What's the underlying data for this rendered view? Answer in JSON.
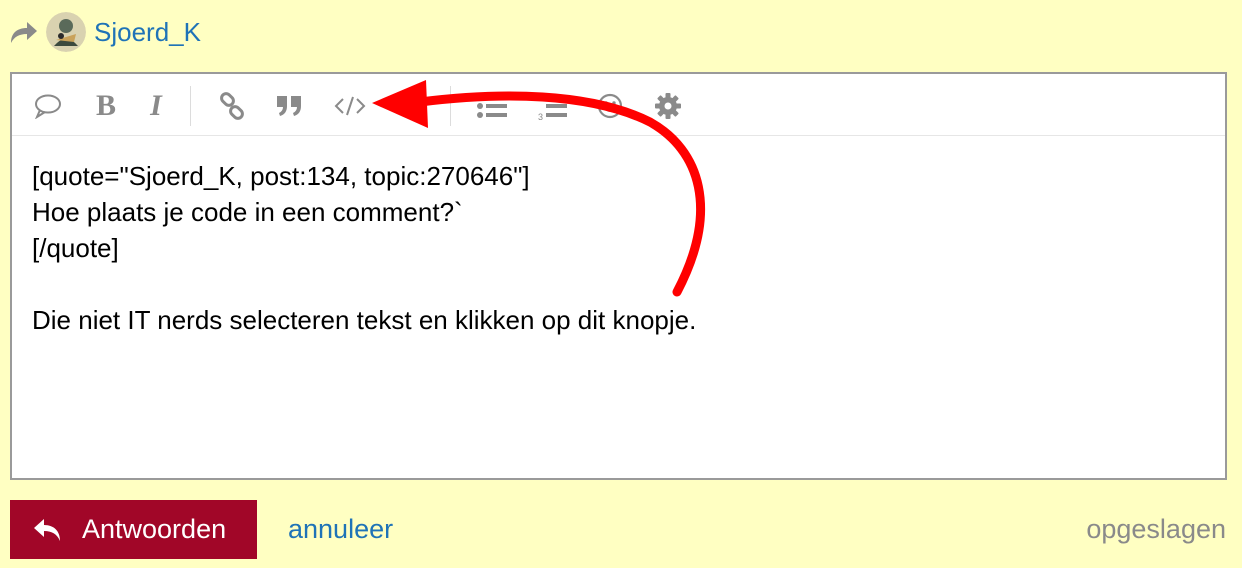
{
  "reply": {
    "username": "Sjoerd_K",
    "reply_icon": "share-arrow-icon",
    "avatar_icon": "user-avatar"
  },
  "toolbar": {
    "buttons": [
      {
        "name": "quote-bubble-icon"
      },
      {
        "name": "bold-button",
        "label": "B"
      },
      {
        "name": "italic-button",
        "label": "I"
      },
      {
        "name": "link-icon"
      },
      {
        "name": "blockquote-icon"
      },
      {
        "name": "code-icon"
      },
      {
        "name": "bullet-list-icon"
      },
      {
        "name": "numbered-list-icon"
      },
      {
        "name": "emoji-icon"
      },
      {
        "name": "gear-icon"
      }
    ]
  },
  "editor": {
    "content": "[quote=\"Sjoerd_K, post:134, topic:270646\"]\nHoe plaats je code in een comment?`\n[/quote]\n\nDie niet IT nerds selecteren tekst en klikken op dit knopje."
  },
  "footer": {
    "submit_label": "Antwoorden",
    "cancel_label": "annuleer",
    "status": "opgeslagen"
  },
  "colors": {
    "background": "#ffffc2",
    "accent": "#a10628",
    "link": "#1f73b7",
    "annotation": "#ff0000"
  }
}
